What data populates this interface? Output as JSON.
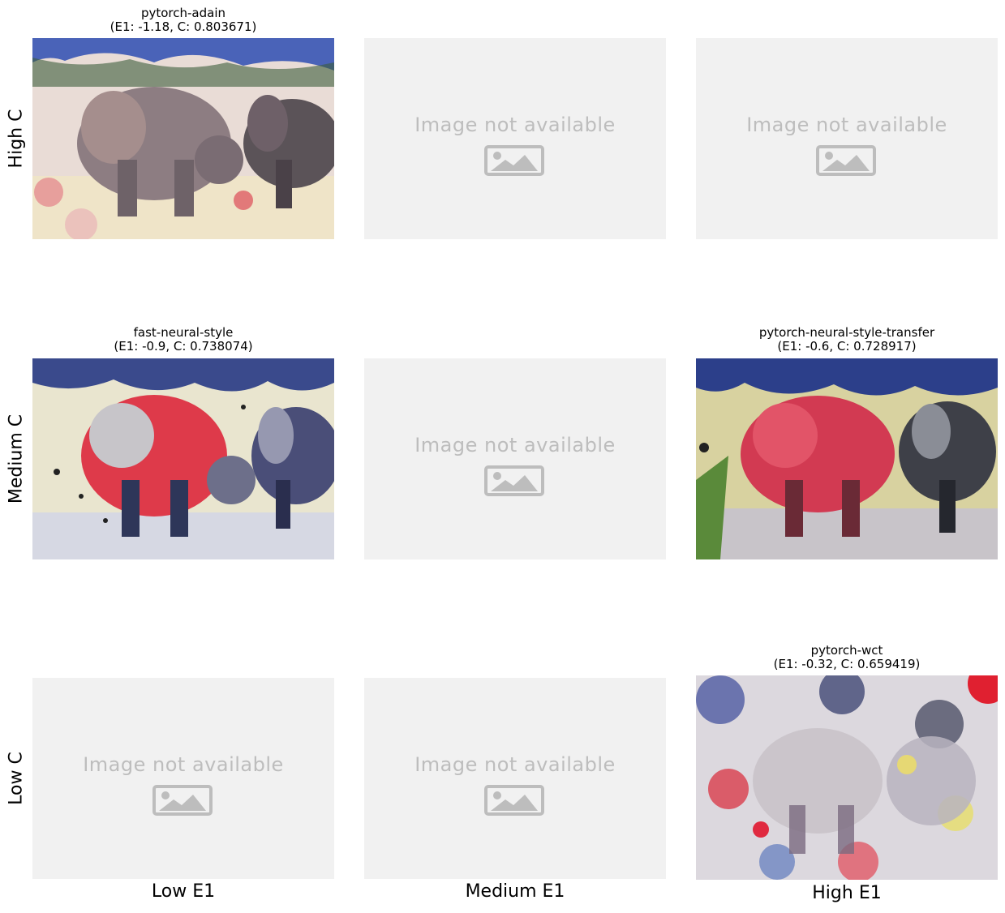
{
  "grid": {
    "row_labels": [
      "High C",
      "Medium C",
      "Low C"
    ],
    "col_labels": [
      "Low E1",
      "Medium E1",
      "High E1"
    ],
    "placeholder_text": "Image not available",
    "cells": {
      "r0c0": {
        "name": "pytorch-adain",
        "stats": "(E1: -1.18, C: 0.803671)"
      },
      "r1c0": {
        "name": "fast-neural-style",
        "stats": "(E1: -0.9, C: 0.738074)"
      },
      "r1c2": {
        "name": "pytorch-neural-style-transfer",
        "stats": "(E1: -0.6, C: 0.728917)"
      },
      "r2c2": {
        "name": "pytorch-wct",
        "stats": "(E1: -0.32, C: 0.659419)"
      }
    }
  },
  "colors": {
    "placeholder_bg": "#f1f1f1",
    "placeholder_fg": "#bdbdbd"
  }
}
